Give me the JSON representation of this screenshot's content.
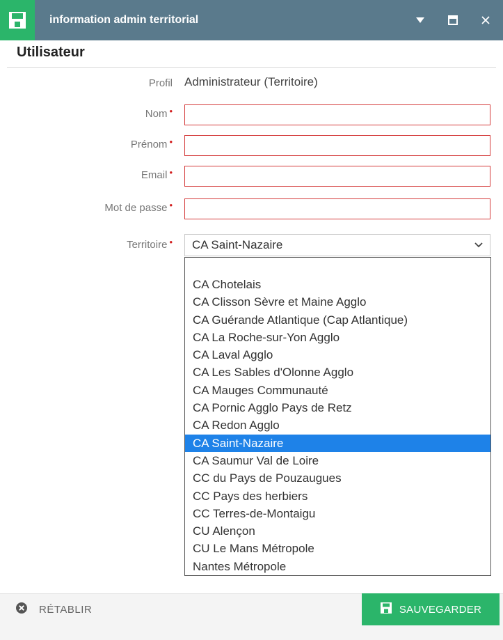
{
  "window": {
    "title": "information admin territorial",
    "icons": {
      "app": "floppy-save-icon",
      "menu": "caret-down-icon",
      "maximize": "window-icon",
      "close": "close-icon"
    }
  },
  "section": {
    "title": "Utilisateur"
  },
  "form": {
    "profil": {
      "label": "Profil",
      "value": "Administrateur (Territoire)"
    },
    "nom": {
      "label": "Nom",
      "value": ""
    },
    "prenom": {
      "label": "Prénom",
      "value": ""
    },
    "email": {
      "label": "Email",
      "value": ""
    },
    "mot_de_passe": {
      "label": "Mot de passe",
      "value": ""
    },
    "territoire": {
      "label": "Territoire",
      "value": "CA Saint-Nazaire"
    },
    "required_marker": "•"
  },
  "dropdown": {
    "options": [
      "",
      "CA Chotelais",
      "CA Clisson Sèvre et Maine Agglo",
      "CA Guérande Atlantique (Cap Atlantique)",
      "CA La Roche-sur-Yon Agglo",
      "CA Laval Agglo",
      "CA Les Sables d'Olonne Agglo",
      "CA Mauges Communauté",
      "CA Pornic Agglo Pays de Retz",
      "CA Redon Agglo",
      "CA Saint-Nazaire",
      "CA Saumur Val de Loire",
      "CC du Pays de Pouzaugues",
      "CC Pays des herbiers",
      "CC Terres-de-Montaigu",
      "CU Alençon",
      "CU Le Mans Métropole",
      "Nantes Métropole"
    ],
    "selected": "CA Saint-Nazaire"
  },
  "footer": {
    "reset_label": "RÉTABLIR",
    "save_label": "SAUVEGARDER"
  },
  "colors": {
    "titlebar": "#5a7a8c",
    "accent_green": "#2bb56a",
    "required_red": "#d21f1f",
    "selection_blue": "#1e82e8"
  }
}
